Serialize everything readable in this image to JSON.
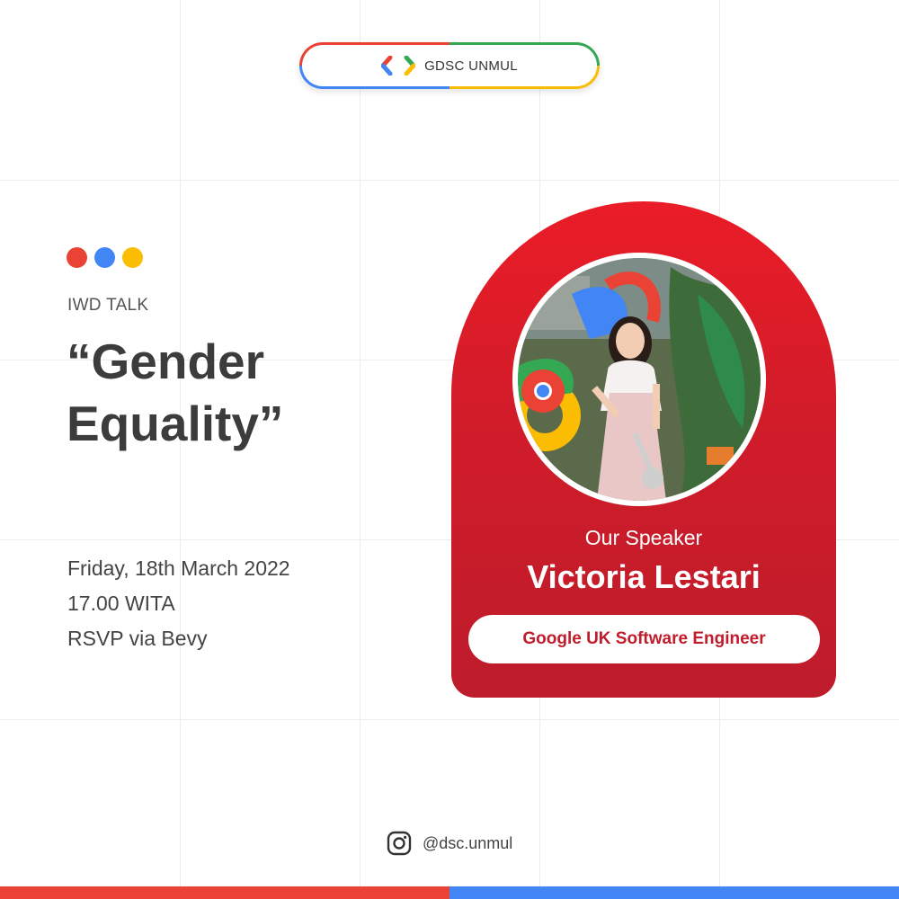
{
  "header": {
    "brand": "GDSC UNMUL",
    "logo_icon": "gdsc-brackets-logo"
  },
  "event": {
    "category": "IWD TALK",
    "title": "“Gender Equality”",
    "date": "Friday, 18th March 2022",
    "time": "17.00 WITA",
    "rsvp": "RSVP via Bevy"
  },
  "speaker": {
    "label": "Our Speaker",
    "name": "Victoria Lestari",
    "role": "Google UK Software Engineer",
    "photo_icon": "speaker-photo"
  },
  "footer": {
    "social_icon": "instagram-icon",
    "handle": "@dsc.unmul"
  },
  "colors": {
    "red": "#EA4335",
    "blue": "#4285F4",
    "yellow": "#FBBC04",
    "green": "#34A853",
    "card_red": "#D11C2A"
  }
}
